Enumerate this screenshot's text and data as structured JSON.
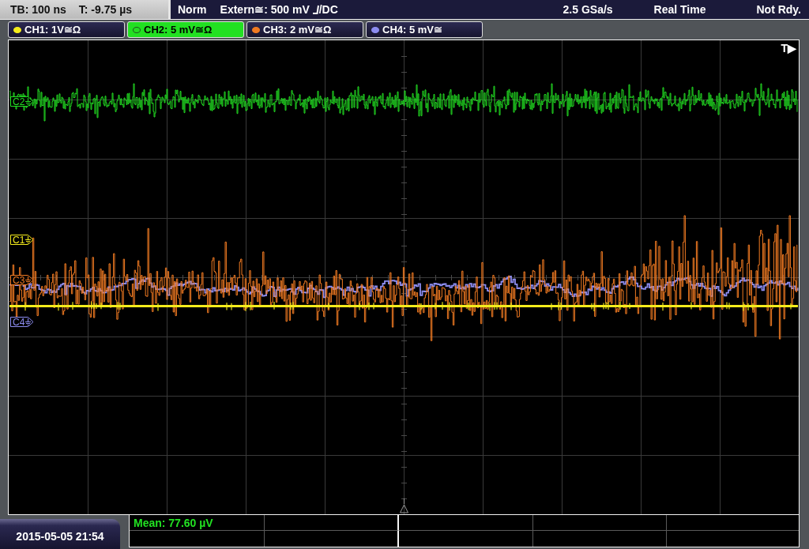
{
  "status_bar": {
    "timebase": "TB: 100 ns",
    "trigger_offset": "T: -9.75 µs",
    "trigger_mode": "Norm",
    "trigger_source": "Extern≅: 500 mV",
    "trigger_coupling": "/DC",
    "sample_rate": "2.5 GSa/s",
    "acquisition_mode": "Real Time",
    "status": "Not Rdy."
  },
  "channels": [
    {
      "label": "CH1: 1V≅Ω",
      "color": "#f4ec1c",
      "selected": false
    },
    {
      "label": "CH2: 5 mV≅Ω",
      "color": "#22e022",
      "selected": true
    },
    {
      "label": "CH3: 2 mV≅Ω",
      "color": "#f07a22",
      "selected": false
    },
    {
      "label": "CH4: 5 mV≅",
      "color": "#8c8cf0",
      "selected": false
    }
  ],
  "plot": {
    "trigger_marker": "T▶",
    "markers": [
      {
        "label": "C2",
        "color": "#22e022"
      },
      {
        "label": "C1",
        "color": "#f4ec1c"
      },
      {
        "label": "C3",
        "color": "#f07a22"
      },
      {
        "label": "C4",
        "color": "#8c8cf0"
      }
    ]
  },
  "measurements": [
    {
      "text": "Mean: 77.60 µV"
    }
  ],
  "timestamp": "2015-05-05 21:54"
}
